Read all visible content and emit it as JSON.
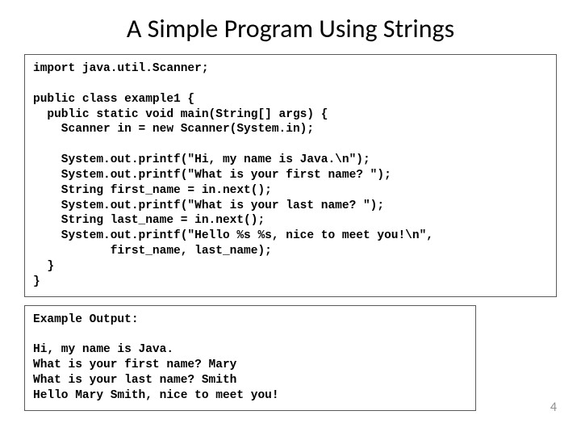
{
  "title": "A Simple Program Using Strings",
  "code": "import java.util.Scanner;\n\npublic class example1 {\n  public static void main(String[] args) {\n    Scanner in = new Scanner(System.in);\n\n    System.out.printf(\"Hi, my name is Java.\\n\");\n    System.out.printf(\"What is your first name? \");\n    String first_name = in.next();\n    System.out.printf(\"What is your last name? \");\n    String last_name = in.next();\n    System.out.printf(\"Hello %s %s, nice to meet you!\\n\",\n           first_name, last_name);\n  }\n}",
  "output": "Example Output:\n\nHi, my name is Java.\nWhat is your first name? Mary\nWhat is your last name? Smith\nHello Mary Smith, nice to meet you!",
  "pageNumber": "4"
}
